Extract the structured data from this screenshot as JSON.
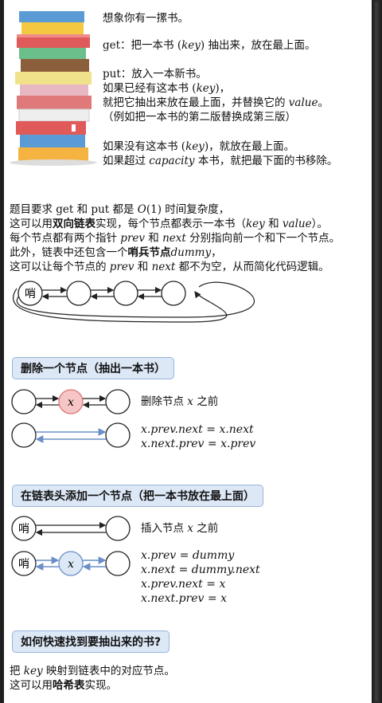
{
  "intro": {
    "l1": "想象你有一摞书。",
    "l2a": "get：把一本书 (",
    "l2k": "key",
    "l2b": ") 抽出来，放在最上面。",
    "l3": "put：放入一本新书。",
    "l4a": "如果已经有这本书 (",
    "l4k": "key",
    "l4b": ")，",
    "l5a": "就把它抽出来放在最上面，并替换它的 ",
    "l5v": "value",
    "l5b": "。",
    "l6": "（例如把一本书的第二版替换成第三版）",
    "l7a": "如果没有这本书 (",
    "l7k": "key",
    "l7b": ")，就放在最上面。",
    "l8a": "如果超过 ",
    "l8c": "capacity",
    "l8b": " 本书，就把最下面的书移除。"
  },
  "para": {
    "p1a": "题目要求 get 和 put 都是 ",
    "p1o": "O",
    "p1n": "(1)",
    "p1b": " 时间复杂度，",
    "p2a": "这可以用",
    "p2bold": "双向链表",
    "p2b": "实现，每个节点都表示一本书（",
    "p2k": "key",
    "p2c": " 和 ",
    "p2v": "value",
    "p2d": "）。",
    "p3a": "每个节点都有两个指针 ",
    "p3p": "prev",
    "p3b": " 和 ",
    "p3n": "next",
    "p3c": " 分别指向前一个和下一个节点。",
    "p4a": "此外，链表中还包含一个",
    "p4bold": "哨兵节点",
    "p4d": "dummy",
    "p4b": "，",
    "p5a": "这可以让每个节点的 ",
    "p5p": "prev",
    "p5b": " 和 ",
    "p5n": "next",
    "p5c": " 都不为空，从而简化代码逻辑。"
  },
  "diagram": {
    "sentinel": "哨",
    "x": "x"
  },
  "section1": {
    "title": "删除一个节点（抽出一本书）",
    "caption_a": "删除节点 ",
    "caption_x": "x",
    "caption_b": " 之前",
    "f1": "x.prev.next = x.next",
    "f2": "x.next.prev = x.prev"
  },
  "section2": {
    "title": "在链表头添加一个节点（把一本书放在最上面）",
    "caption_a": "插入节点 ",
    "caption_x": "x",
    "caption_b": " 之前",
    "f1": "x.prev = dummy",
    "f2": "x.next = dummy.next",
    "f3": "x.prev.next = x",
    "f4": "x.next.prev = x"
  },
  "section3": {
    "title": "如何快速找到要抽出来的书?",
    "l1a": "把 ",
    "l1k": "key",
    "l1b": " 映射到链表中的对应节点。",
    "l2a": "这可以用",
    "l2bold": "哈希表",
    "l2b": "实现。"
  },
  "colors": {
    "blue": "#6a8fc7",
    "header_bg": "#dde8f7",
    "header_border": "#98b4dc",
    "node_red": "#f6c5c5"
  }
}
